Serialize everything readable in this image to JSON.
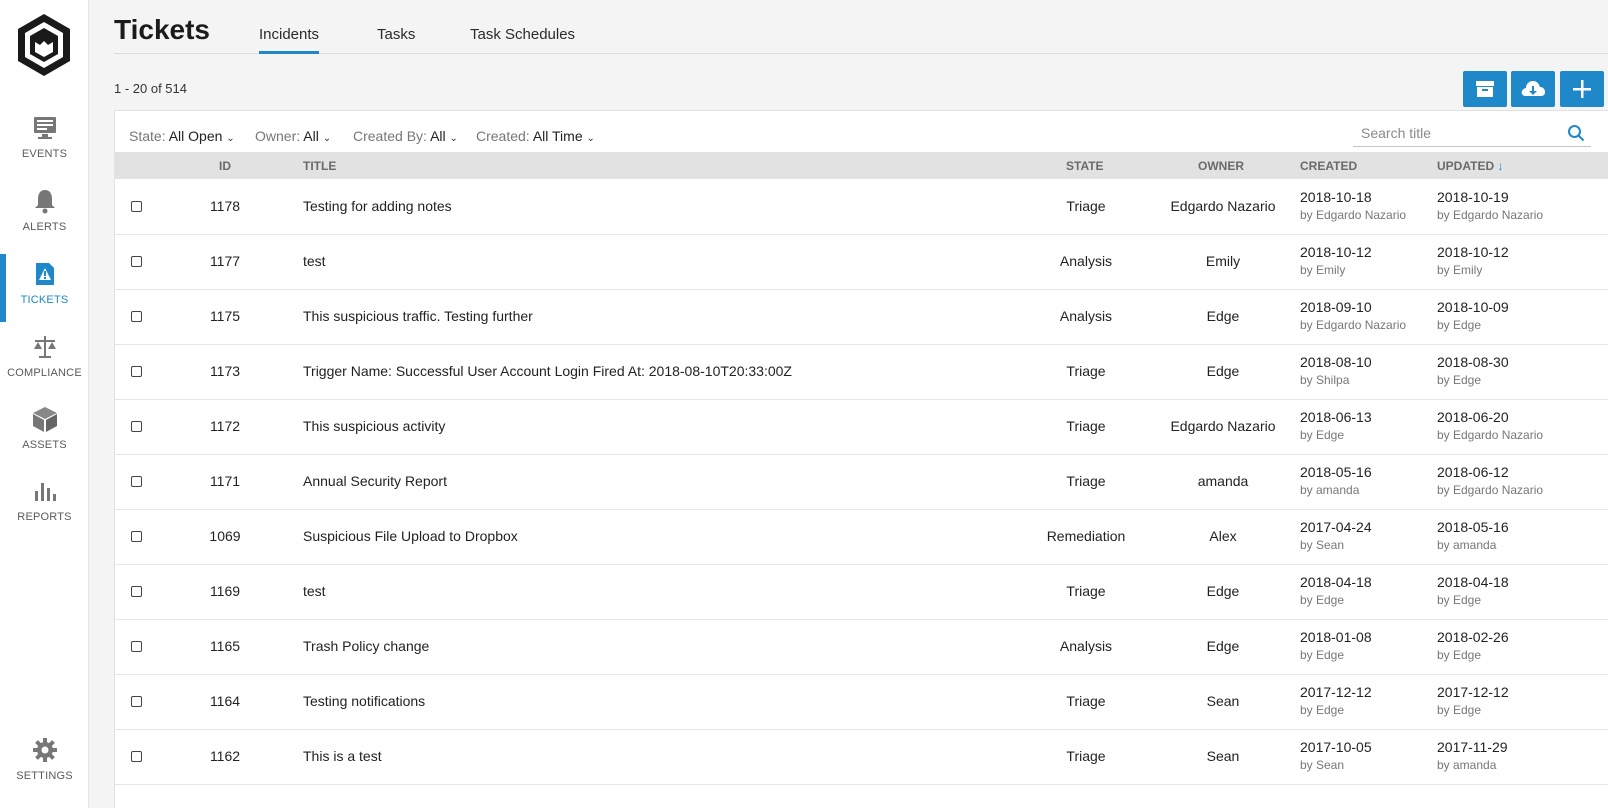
{
  "sidebar": {
    "items": [
      {
        "label": "EVENTS",
        "icon": "monitor-icon"
      },
      {
        "label": "ALERTS",
        "icon": "bell-icon"
      },
      {
        "label": "TICKETS",
        "icon": "ticket-icon",
        "active": true
      },
      {
        "label": "COMPLIANCE",
        "icon": "scale-icon"
      },
      {
        "label": "ASSETS",
        "icon": "cube-icon"
      },
      {
        "label": "REPORTS",
        "icon": "bar-chart-icon"
      }
    ],
    "settings_label": "SETTINGS"
  },
  "header": {
    "title": "Tickets",
    "tabs": [
      "Incidents",
      "Tasks",
      "Task Schedules"
    ],
    "active_tab": "Incidents",
    "range": "1 - 20 of 514"
  },
  "actions": [
    "archive-icon",
    "cloud-download-icon",
    "plus-icon"
  ],
  "filters": {
    "state": {
      "label": "State:",
      "value": "All Open"
    },
    "owner": {
      "label": "Owner:",
      "value": "All"
    },
    "created_by": {
      "label": "Created By:",
      "value": "All"
    },
    "created": {
      "label": "Created:",
      "value": "All Time"
    }
  },
  "search": {
    "placeholder": "Search title"
  },
  "columns": {
    "id": "ID",
    "title": "TITLE",
    "state": "STATE",
    "owner": "OWNER",
    "created": "CREATED",
    "updated": "UPDATED"
  },
  "rows": [
    {
      "id": "1178",
      "title": "Testing for adding notes",
      "state": "Triage",
      "owner": "Edgardo Nazario",
      "created": "2018-10-18",
      "created_by": "by Edgardo Nazario",
      "updated": "2018-10-19",
      "updated_by": "by Edgardo Nazario"
    },
    {
      "id": "1177",
      "title": "test",
      "state": "Analysis",
      "owner": "Emily",
      "created": "2018-10-12",
      "created_by": "by Emily",
      "updated": "2018-10-12",
      "updated_by": "by Emily"
    },
    {
      "id": "1175",
      "title": "This suspicious traffic. Testing further",
      "state": "Analysis",
      "owner": "Edge",
      "created": "2018-09-10",
      "created_by": "by Edgardo Nazario",
      "updated": "2018-10-09",
      "updated_by": "by Edge"
    },
    {
      "id": "1173",
      "title": "Trigger Name: Successful User Account Login Fired At: 2018-08-10T20:33:00Z",
      "state": "Triage",
      "owner": "Edge",
      "created": "2018-08-10",
      "created_by": "by Shilpa",
      "updated": "2018-08-30",
      "updated_by": "by Edge"
    },
    {
      "id": "1172",
      "title": "This suspicious activity",
      "state": "Triage",
      "owner": "Edgardo Nazario",
      "created": "2018-06-13",
      "created_by": "by Edge",
      "updated": "2018-06-20",
      "updated_by": "by Edgardo Nazario"
    },
    {
      "id": "1171",
      "title": "Annual Security Report",
      "state": "Triage",
      "owner": "amanda",
      "created": "2018-05-16",
      "created_by": "by amanda",
      "updated": "2018-06-12",
      "updated_by": "by Edgardo Nazario"
    },
    {
      "id": "1069",
      "title": "Suspicious File Upload to Dropbox",
      "state": "Remediation",
      "owner": "Alex",
      "created": "2017-04-24",
      "created_by": "by Sean",
      "updated": "2018-05-16",
      "updated_by": "by amanda"
    },
    {
      "id": "1169",
      "title": "test",
      "state": "Triage",
      "owner": "Edge",
      "created": "2018-04-18",
      "created_by": "by Edge",
      "updated": "2018-04-18",
      "updated_by": "by Edge"
    },
    {
      "id": "1165",
      "title": "Trash Policy change",
      "state": "Analysis",
      "owner": "Edge",
      "created": "2018-01-08",
      "created_by": "by Edge",
      "updated": "2018-02-26",
      "updated_by": "by Edge"
    },
    {
      "id": "1164",
      "title": "Testing notifications",
      "state": "Triage",
      "owner": "Sean",
      "created": "2017-12-12",
      "created_by": "by Edge",
      "updated": "2017-12-12",
      "updated_by": "by Edge"
    },
    {
      "id": "1162",
      "title": "This is a test",
      "state": "Triage",
      "owner": "Sean",
      "created": "2017-10-05",
      "created_by": "by Sean",
      "updated": "2017-11-29",
      "updated_by": "by amanda"
    }
  ],
  "colors": {
    "accent": "#1e88c8",
    "header_bg": "#e2e2e2"
  }
}
